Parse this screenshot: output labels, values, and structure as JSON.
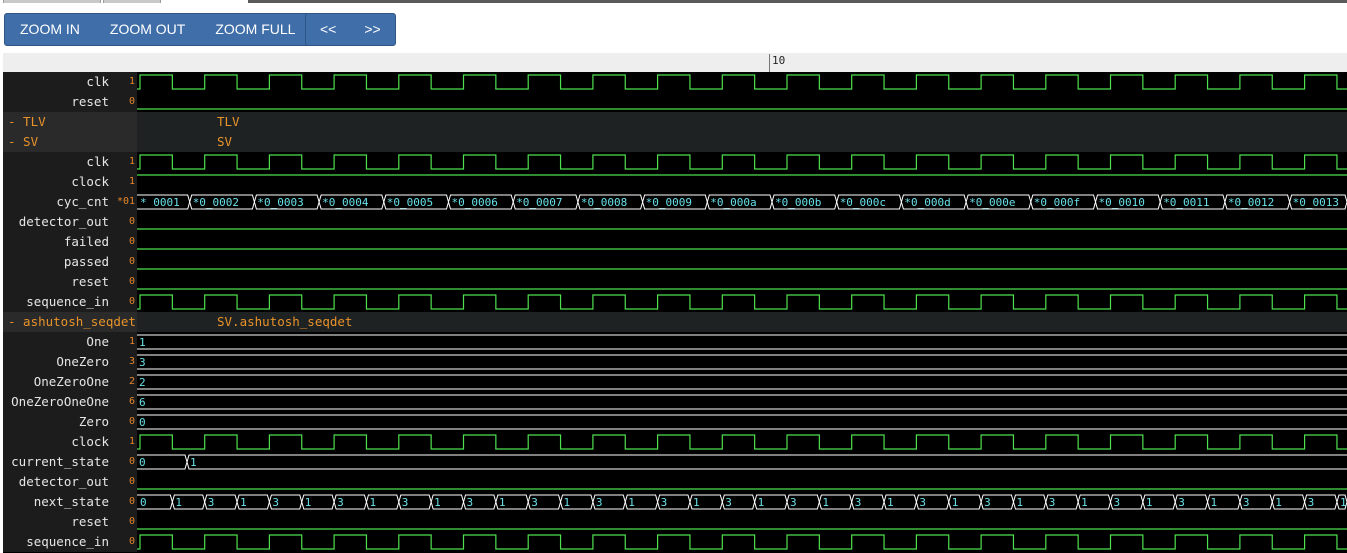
{
  "toolbar": {
    "zoom_in": "ZOOM IN",
    "zoom_out": "ZOOM OUT",
    "zoom_full": "ZOOM FULL",
    "prev": "<<",
    "next": ">>"
  },
  "ruler": {
    "label": "10"
  },
  "colors": {
    "signal": "#4ee04e",
    "bus_text": "#68e0e8",
    "value": "#e8862a",
    "group": "#e8932a",
    "background": "#000000",
    "button": "#3f6ea8"
  },
  "rows": [
    {
      "name": "clk",
      "value": "1",
      "kind": "clock"
    },
    {
      "name": "reset",
      "value": "0",
      "kind": "low"
    },
    {
      "group": true,
      "name": "TLV",
      "label": "TLV"
    },
    {
      "group": true,
      "name": "SV",
      "label": "SV"
    },
    {
      "name": "clk",
      "value": "1",
      "kind": "clock"
    },
    {
      "name": "clock",
      "value": "1",
      "kind": "high"
    },
    {
      "name": "cyc_cnt",
      "value": "*01",
      "kind": "bus",
      "segments": [
        "* 0001",
        "*0_0002",
        "*0_0003",
        "*0_0004",
        "*0_0005",
        "*0_0006",
        "*0_0007",
        "*0_0008",
        "*0_0009",
        "*0_000a",
        "*0_000b",
        "*0_000c",
        "*0_000d",
        "*0_000e",
        "*0_000f",
        "*0_0010",
        "*0_0011",
        "*0_0012",
        "*0_0013"
      ]
    },
    {
      "name": "detector_out",
      "value": "0",
      "kind": "low"
    },
    {
      "name": "failed",
      "value": "0",
      "kind": "low"
    },
    {
      "name": "passed",
      "value": "0",
      "kind": "low"
    },
    {
      "name": "reset",
      "value": "0",
      "kind": "low"
    },
    {
      "name": "sequence_in",
      "value": "0",
      "kind": "clock"
    },
    {
      "group": true,
      "name": "ashutosh_seqdet",
      "label": "SV.ashutosh_seqdet"
    },
    {
      "name": "One",
      "value": "1",
      "kind": "const",
      "text": "1"
    },
    {
      "name": "OneZero",
      "value": "3",
      "kind": "const",
      "text": "3"
    },
    {
      "name": "OneZeroOne",
      "value": "2",
      "kind": "const",
      "text": "2"
    },
    {
      "name": "OneZeroOneOne",
      "value": "6",
      "kind": "const",
      "text": "6"
    },
    {
      "name": "Zero",
      "value": "0",
      "kind": "const",
      "text": "0"
    },
    {
      "name": "clock",
      "value": "1",
      "kind": "clock"
    },
    {
      "name": "current_state",
      "value": "0",
      "kind": "state",
      "text0": "0",
      "text1": "1"
    },
    {
      "name": "detector_out",
      "value": "0",
      "kind": "low"
    },
    {
      "name": "next_state",
      "value": "0",
      "kind": "halfbus",
      "segments": [
        "0",
        "1",
        "3",
        "1",
        "3",
        "1",
        "3",
        "1",
        "3",
        "1",
        "3",
        "1",
        "3",
        "1",
        "3",
        "1",
        "3",
        "1",
        "3",
        "1",
        "3",
        "1",
        "3",
        "1",
        "3",
        "1",
        "3",
        "1",
        "3",
        "1",
        "3",
        "1",
        "3",
        "1",
        "3",
        "1",
        "3",
        "1"
      ]
    },
    {
      "name": "reset",
      "value": "0",
      "kind": "low"
    },
    {
      "name": "sequence_in",
      "value": "0",
      "kind": "clock"
    }
  ]
}
